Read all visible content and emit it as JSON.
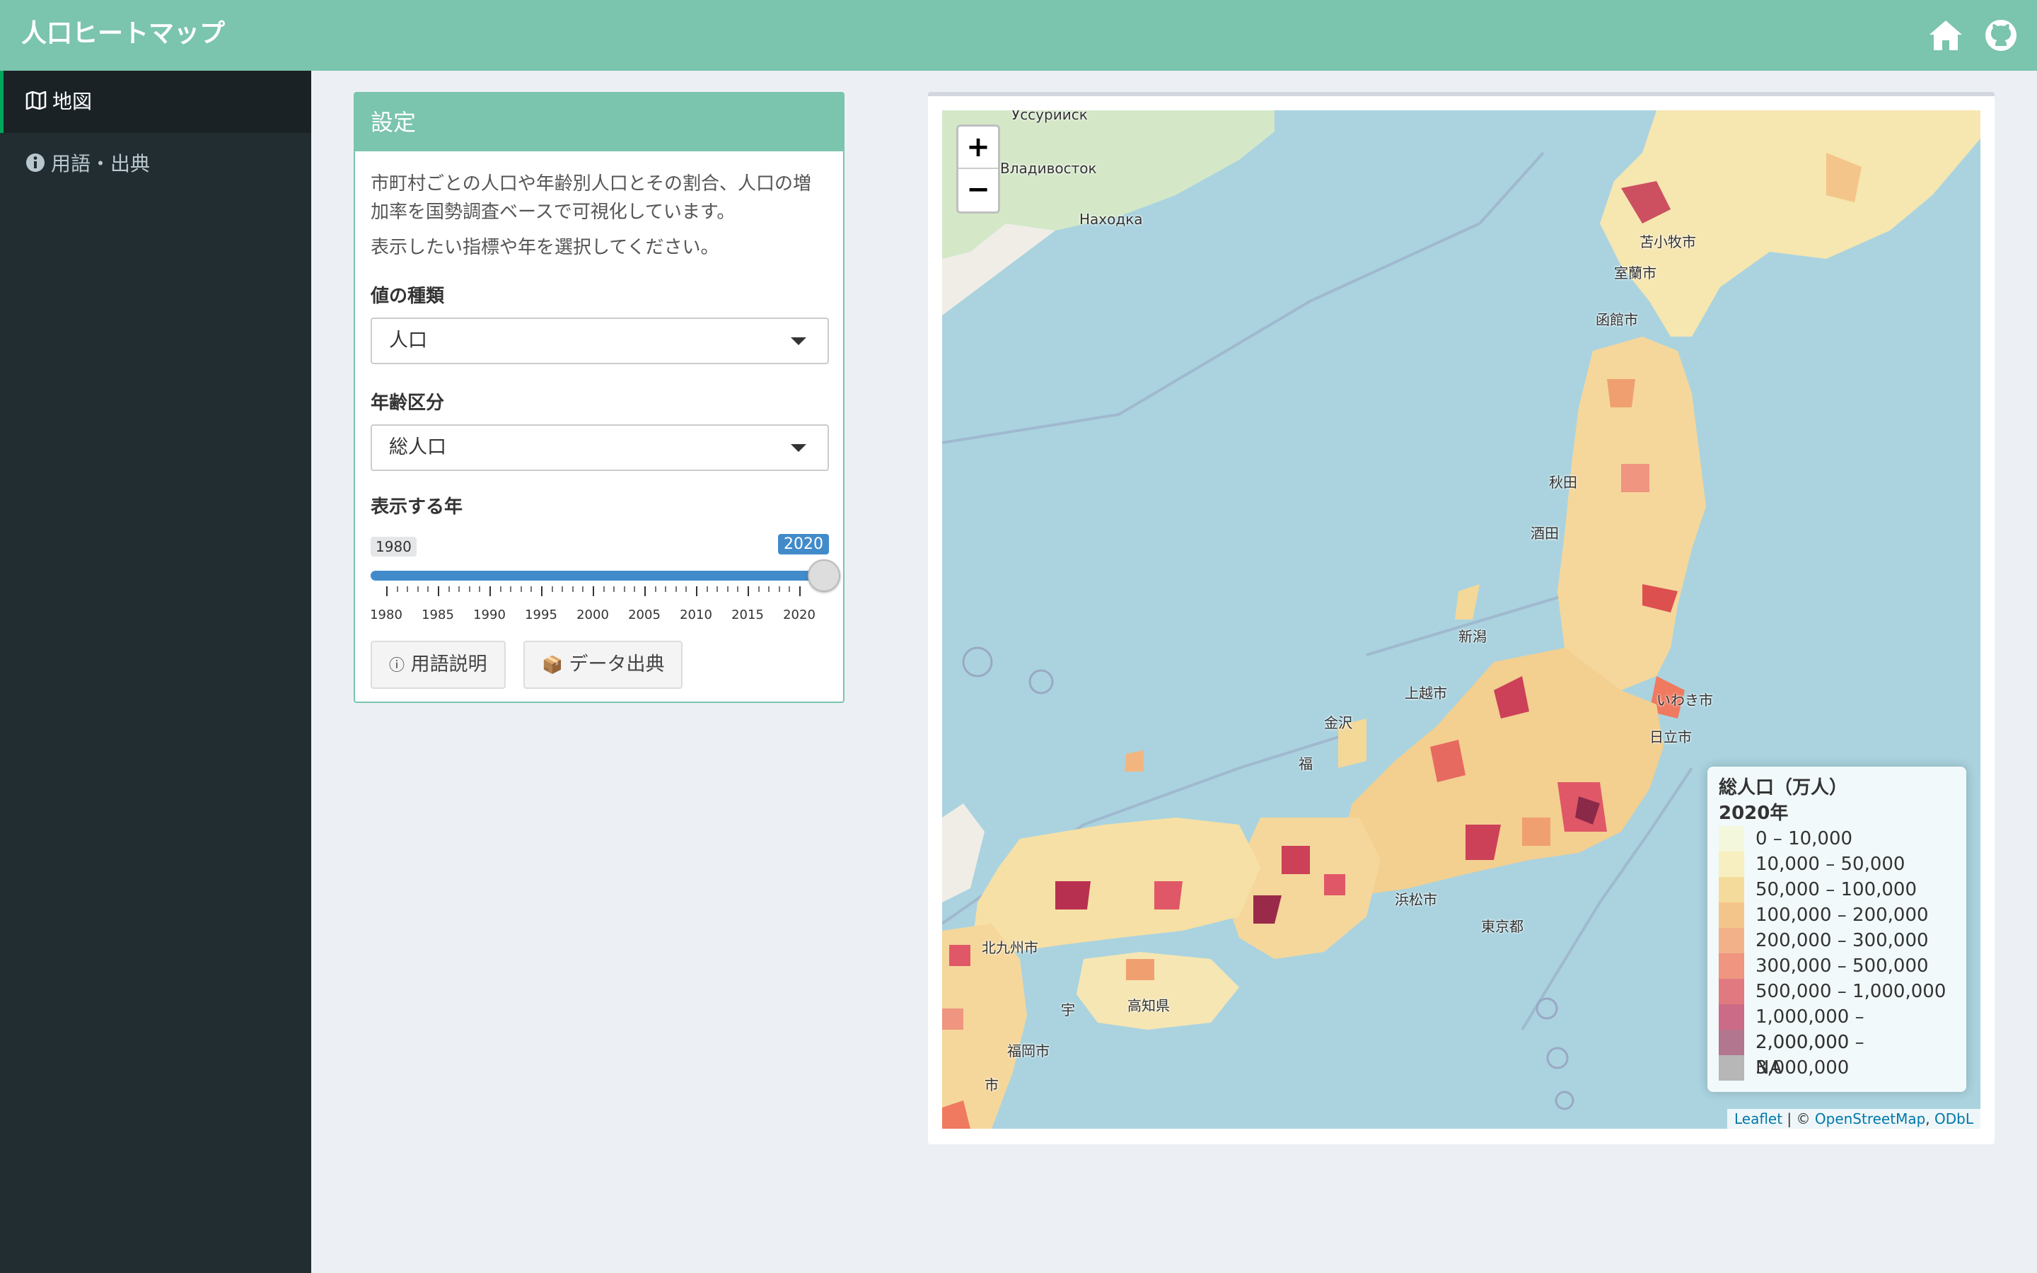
{
  "app": {
    "title": "人口ヒートマップ"
  },
  "header_icons": {
    "home": "home-icon",
    "github": "github-icon"
  },
  "sidebar": {
    "items": [
      {
        "label": "地図",
        "icon": "map-icon",
        "active": true
      },
      {
        "label": "用語・出典",
        "icon": "info-circle-icon",
        "active": false
      }
    ]
  },
  "settings": {
    "title": "設定",
    "description": "市町村ごとの人口や年齢別人口とその割合、人口の増加率を国勢調査ベースで可視化しています。",
    "instruction": "表示したい指標や年を選択してください。",
    "value_type": {
      "label": "値の種類",
      "selected": "人口"
    },
    "age_group": {
      "label": "年齢区分",
      "selected": "総人口"
    },
    "year": {
      "label": "表示する年",
      "min": 1980,
      "max": 2020,
      "value": 2020,
      "min_label": "1980",
      "value_label": "2020",
      "ticks": [
        "1980",
        "1985",
        "1990",
        "1995",
        "2000",
        "2005",
        "2010",
        "2015",
        "2020"
      ]
    },
    "buttons": {
      "glossary": "用語説明",
      "glossary_icon": "ⓘ",
      "source": "データ出典",
      "source_icon": "📦"
    }
  },
  "map": {
    "zoom_in": "+",
    "zoom_out": "−",
    "labels": [
      "Уссурийск",
      "Владивосток",
      "Находка",
      "苫小牧市",
      "室蘭市",
      "函館市",
      "秋田",
      "酒田",
      "新潟",
      "上越市",
      "金沢",
      "福",
      "いわき市",
      "日立市",
      "浜松市",
      "東京都",
      "北九州市",
      "福岡市",
      "高知県",
      "宇",
      "市"
    ],
    "legend": {
      "title": "総人口（万人）",
      "subtitle": "2020年",
      "items": [
        {
          "label": "0 – 10,000",
          "color": "#f3f7dc"
        },
        {
          "label": "10,000 – 50,000",
          "color": "#f7efc0"
        },
        {
          "label": "50,000 – 100,000",
          "color": "#f5db9b"
        },
        {
          "label": "100,000 – 200,000",
          "color": "#f4c58a"
        },
        {
          "label": "200,000 – 300,000",
          "color": "#f3b18a"
        },
        {
          "label": "300,000 – 500,000",
          "color": "#ef9580"
        },
        {
          "label": "500,000 – 1,000,000",
          "color": "#e07a80"
        },
        {
          "label": "1,000,000 – 2,000,000",
          "color": "#cc6b87"
        },
        {
          "label": "2,000,000 – 3,000,000",
          "color": "#b2778f"
        },
        {
          "label": "NA",
          "color": "#b7b7b7"
        }
      ]
    },
    "attribution": {
      "leaflet": "Leaflet",
      "sep": " | © ",
      "osm": "OpenStreetMap",
      "comma": ", ",
      "odbl": "ODbL"
    }
  }
}
